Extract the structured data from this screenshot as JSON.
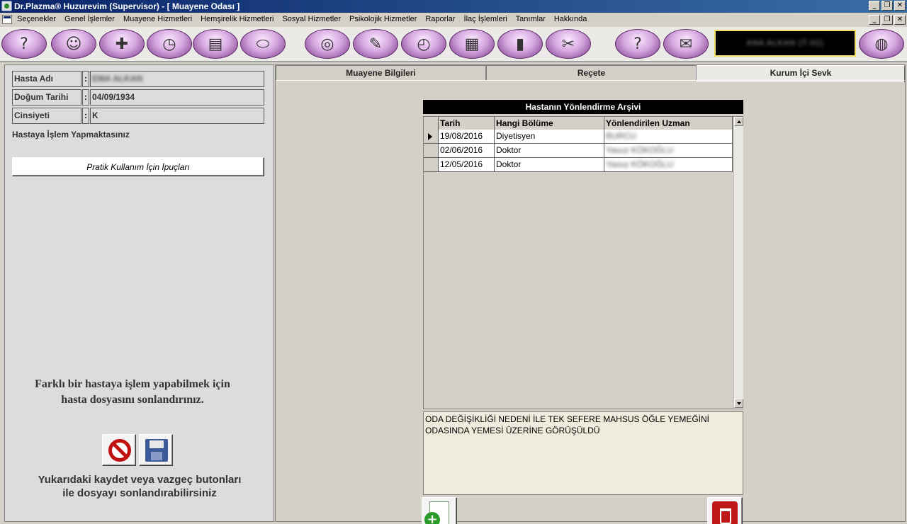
{
  "window": {
    "title": "Dr.Plazma® Huzurevim (Supervisor) - [ Muayene Odası ]",
    "btn_minimize": "_",
    "btn_restore": "❐",
    "btn_close": "✕"
  },
  "menu": {
    "items": [
      "Seçenekler",
      "Genel İşlemler",
      "Muayene Hizmetleri",
      "Hemşirelik Hizmetleri",
      "Sosyal Hizmetler",
      "Psikolojik Hizmetler",
      "Raporlar",
      "İlaç İşlemleri",
      "Tanımlar",
      "Hakkında"
    ]
  },
  "toolbar": {
    "icons": [
      "help-head-icon",
      "doctors-icon",
      "nurse-tools-icon",
      "timer-icon",
      "doc-file-icon",
      "pills-icon",
      "spiral-icon",
      "syringe-icon",
      "chart-clock-icon",
      "clipboard-icon",
      "bar-chart-icon",
      "tools-icon",
      "help-note-icon",
      "mail-icon",
      "globe-arrow-icon"
    ],
    "user_box_text": "ANA ALKAN (T-02)"
  },
  "patient": {
    "name_label": "Hasta Adı",
    "name_value": "EMA ALKAN",
    "dob_label": "Doğum Tarihi",
    "dob_value": "04/09/1934",
    "gender_label": "Cinsiyeti",
    "gender_value": "K",
    "colon": ":",
    "working_on": "Hastaya İşlem Yapmaktasınız",
    "tips_button": "Pratik Kullanım İçin İpuçları",
    "close_file_msg": "Farklı bir hastaya işlem yapabilmek için hasta dosyasını sonlandırınız.",
    "save_cancel_msg": "Yukarıdaki kaydet veya vazgeç butonları ile dosyayı sonlandırabilirsiniz"
  },
  "tabs": [
    {
      "label": "Muayene Bilgileri"
    },
    {
      "label": "Reçete"
    },
    {
      "label": "Kurum İçi Sevk"
    }
  ],
  "archive": {
    "title": "Hastanın Yönlendirme Arşivi",
    "columns": [
      "Tarih",
      "Hangi Bölüme",
      "Yönlendirilen Uzman"
    ],
    "rows": [
      [
        "19/08/2016",
        "Diyetisyen",
        "BURCU"
      ],
      [
        "02/06/2016",
        "Doktor",
        "Yavuz KÖKOĞLU"
      ],
      [
        "12/05/2016",
        "Doktor",
        "Yavuz KÖKOĞLU"
      ]
    ]
  },
  "note": {
    "text": "ODA DEĞİŞİKLİĞİ NEDENİ İLE TEK SEFERE MAHSUS ÖĞLE YEMEĞİNİ ODASINDA YEMESİ ÜZERİNE GÖRÜŞÜLDÜ"
  }
}
